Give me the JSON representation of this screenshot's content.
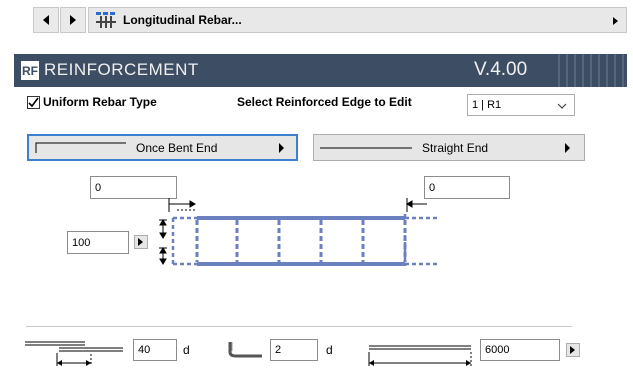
{
  "header": {
    "title": "Longitudinal Rebar..."
  },
  "banner": {
    "logo_text": "RF",
    "title": "REINFORCEMENT",
    "version": "V.4.00"
  },
  "options": {
    "uniform_label": "Uniform Rebar Type",
    "uniform_checked": true,
    "edge_label": "Select Reinforced Edge to Edit",
    "edge_value": "1 | R1"
  },
  "end_types": {
    "left_label": "Once Bent End",
    "right_label": "Straight End"
  },
  "diagram": {
    "left_input": "0",
    "right_input": "0",
    "spacing_input": "100"
  },
  "footer": {
    "lap_value": "40",
    "lap_unit": "d",
    "bend_value": "2",
    "bend_unit": "d",
    "length_value": "6000"
  },
  "colors": {
    "banner_bg": "#3d4d63",
    "rebar_blue": "#6c7fbf",
    "focus_border": "#3f7fd0"
  }
}
